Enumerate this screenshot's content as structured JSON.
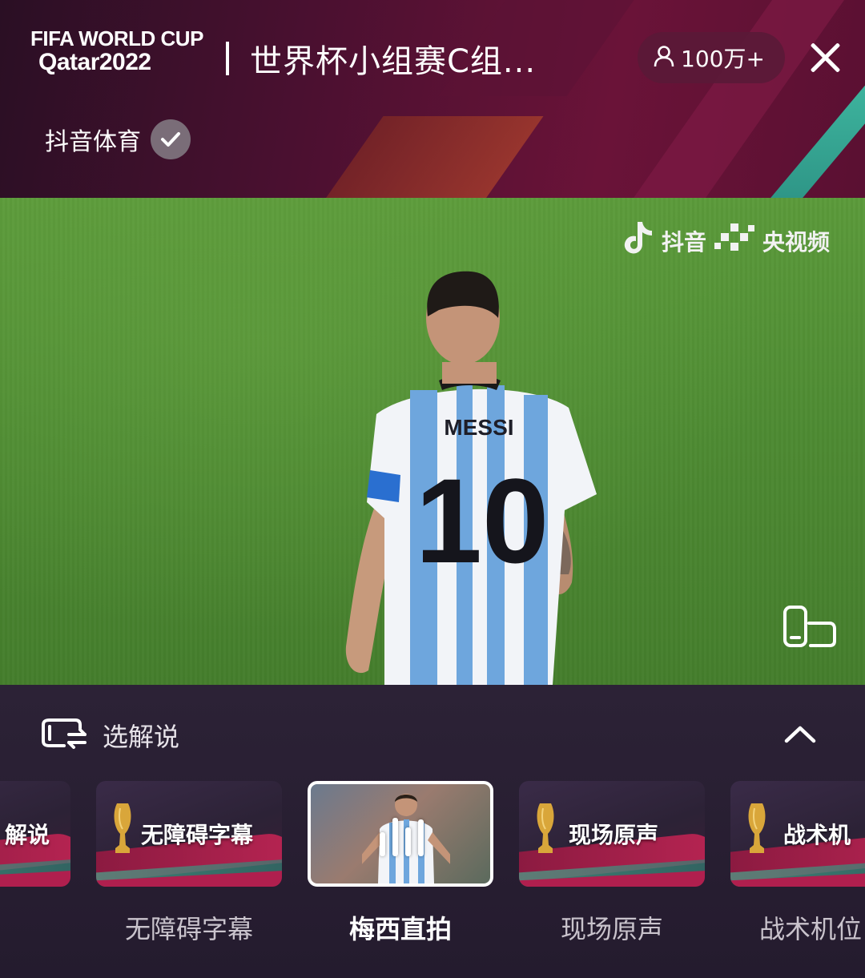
{
  "header": {
    "logo_line1": "FIFA WORLD CUP",
    "logo_line2": "Qatar2022",
    "title": "世界杯小组赛C组...",
    "viewers": "100万+",
    "channel_name": "抖音体育"
  },
  "video": {
    "watermark_douyin": "抖音",
    "watermark_cctv": "央视频",
    "player_name": "MESSI",
    "player_number": "10"
  },
  "panel": {
    "label": "选解说",
    "options": [
      {
        "title": "解说",
        "label": "解说",
        "active": false
      },
      {
        "title": "无障碍字幕",
        "label": "无障碍字幕",
        "active": false
      },
      {
        "title": "",
        "label": "梅西直拍",
        "active": true
      },
      {
        "title": "现场原声",
        "label": "现场原声",
        "active": false
      },
      {
        "title": "战术机",
        "label": "战术机位",
        "active": false
      }
    ]
  },
  "colors": {
    "header_bg": "#4a1030",
    "panel_bg": "#2c2236",
    "accent_red": "#b72452",
    "accent_teal": "#3fb7a0",
    "pitch_green": "#4d8a32"
  }
}
